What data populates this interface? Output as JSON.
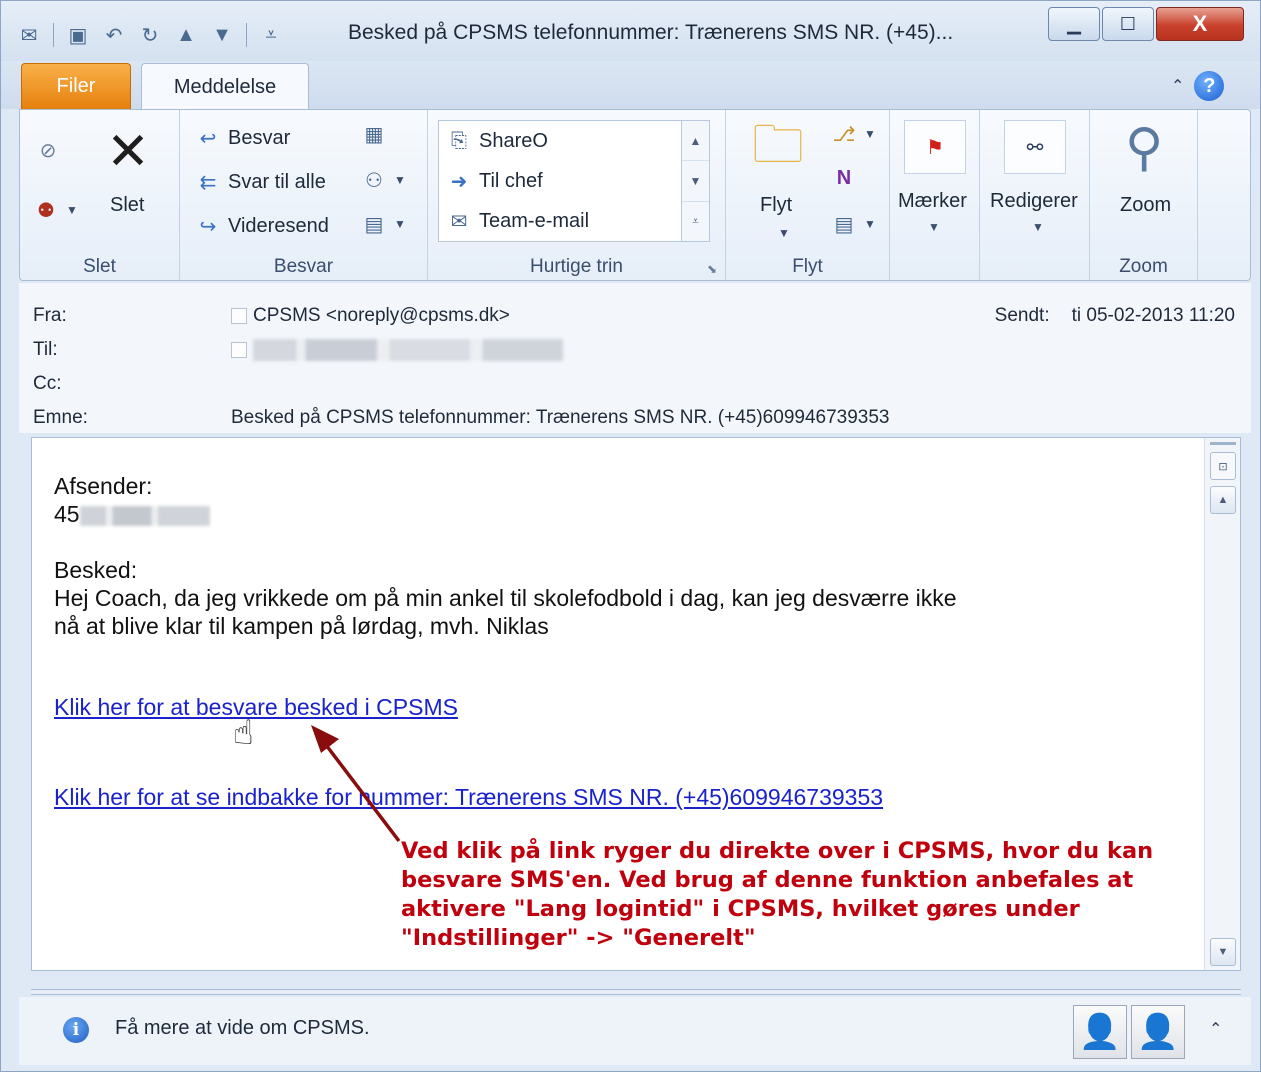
{
  "window": {
    "title": "Besked på CPSMS telefonnummer: Trænerens SMS NR. (+45)...",
    "minimize_label": "▭",
    "maximize_label": "▢",
    "close_label": "X"
  },
  "qat": {
    "icons": [
      "mail-icon",
      "save-icon",
      "undo-icon",
      "redo-icon",
      "up-icon",
      "down-icon",
      "customize-icon"
    ]
  },
  "tabs": {
    "filer": "Filer",
    "meddelelse": "Meddelelse"
  },
  "ribbon": {
    "slet_group": {
      "label": "Slet",
      "slet_button": "Slet"
    },
    "besvar_group": {
      "label": "Besvar",
      "besvar": "Besvar",
      "svar_til_alle": "Svar til alle",
      "videresend": "Videresend"
    },
    "hurtige_trin_group": {
      "label": "Hurtige trin",
      "items": [
        "ShareO",
        "Til chef",
        "Team-e-mail"
      ]
    },
    "flyt_group": {
      "label": "Flyt",
      "flyt_button": "Flyt"
    },
    "maerker": "Mærker",
    "redigerer": "Redigerer",
    "zoom_group": {
      "label": "Zoom",
      "zoom_button": "Zoom"
    }
  },
  "header": {
    "from_label": "Fra:",
    "from_value": "CPSMS <noreply@cpsms.dk>",
    "to_label": "Til:",
    "cc_label": "Cc:",
    "subject_label": "Emne:",
    "subject_value": "Besked på CPSMS telefonnummer: Trænerens SMS NR. (+45)609946739353",
    "sent_label": "Sendt:",
    "sent_value": "ti 05-02-2013 11:20"
  },
  "message": {
    "sender_heading": "Afsender:",
    "sender_prefix": "45",
    "message_heading": "Besked:",
    "line1": "Hej Coach, da jeg vrikkede om på min ankel til skolefodbold i dag, kan jeg desværre ikke",
    "line2": "nå at blive klar til kampen på lørdag, mvh. Niklas",
    "reply_link": "Klik her for at besvare besked i CPSMS",
    "inbox_link": "Klik her for at se indbakke for nummer: Trænerens SMS NR. (+45)609946739353"
  },
  "annotation": {
    "line1": "Ved klik på link ryger du direkte over i CPSMS, hvor du kan",
    "line2": "besvare SMS'en. Ved brug af denne funktion anbefales at",
    "line3": "aktivere \"Lang logintid\" i CPSMS, hvilket gøres under",
    "line4": "\"Indstillinger\" -> \"Generelt\"",
    "color": "#c0000c"
  },
  "people_pane": {
    "text": "Få mere at vide om CPSMS."
  },
  "colors": {
    "link": "#1a22cc",
    "filer_tab": "#f39c1f",
    "close_button": "#c9412d"
  }
}
